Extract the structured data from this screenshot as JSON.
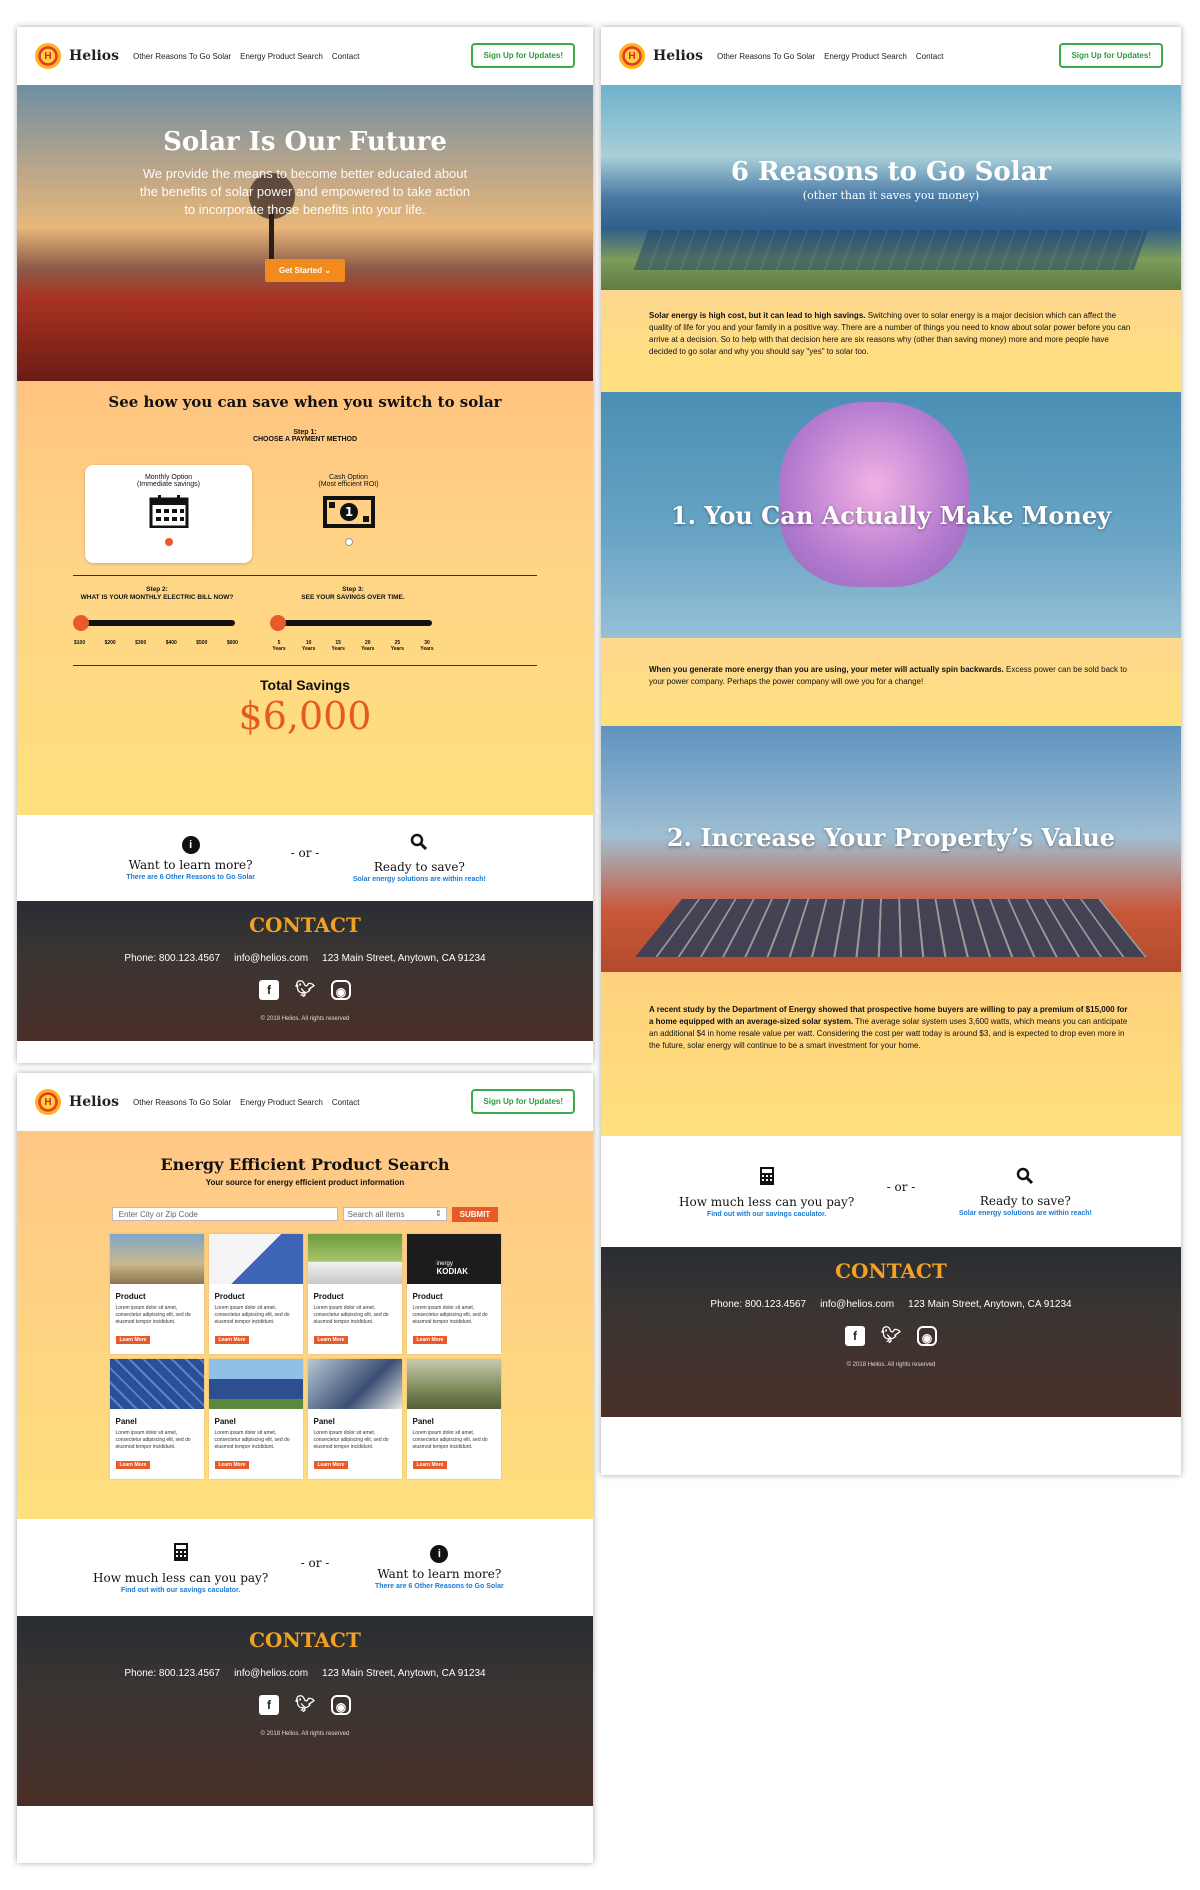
{
  "nav": {
    "brand": "Helios",
    "logo_letter": "H",
    "links": [
      "Other Reasons To Go Solar",
      "Energy Product Search",
      "Contact"
    ],
    "signup": "Sign Up for Updates!"
  },
  "home": {
    "hero_title": "Solar Is Our Future",
    "hero_text": "We provide the means to become better educated about the benefits of solar power and empowered to take action to incorporate those benefits into your life.",
    "hero_button": "Get Started",
    "calc_title": "See how you can save when you switch to solar",
    "step1_label": "Step 1:",
    "step1_text": "CHOOSE A PAYMENT METHOD",
    "option1_title": "Monthly Option",
    "option1_sub": "(Immediate savings)",
    "option2_title": "Cash Option",
    "option2_sub": "(Most efficient ROI)",
    "step2_label": "Step 2:",
    "step2_text": "WHAT IS YOUR MONTHLY ELECTRIC BILL NOW?",
    "step3_label": "Step 3:",
    "step3_text": "SEE YOUR SAVINGS OVER TIME.",
    "bill_ticks": [
      "$100",
      "$200",
      "$300",
      "$400",
      "$500",
      "$600"
    ],
    "year_ticks": [
      "5 Years",
      "10 Years",
      "15 Years",
      "20 Years",
      "25 Years",
      "30 Years"
    ],
    "total_label": "Total Savings",
    "total_value": "$6,000",
    "cta1_title": "Want to learn more?",
    "cta1_sub": "There are 6 Other Reasons to Go Solar",
    "or": "- or -",
    "cta2_title": "Ready to save?",
    "cta2_sub": "Solar energy solutions are within reach!"
  },
  "contact": {
    "title": "CONTACT",
    "phone": "Phone: 800.123.4567",
    "email": "info@helios.com",
    "address": "123 Main Street, Anytown, CA 91234",
    "copyright": "© 2018 Helios. All rights reserved"
  },
  "reasons": {
    "hero_title": "6 Reasons to Go Solar",
    "hero_sub": "(other than it saves you money)",
    "intro_bold": "Solar energy is high cost, but it can lead to high savings.",
    "intro": " Switching over to solar energy is a major decision which can affect the quality of life for you and your family in a positive way. There are a number of things you need to know about solar power before you can arrive at a decision. So to help with that decision here are six reasons why (other than saving money) more and more people have decided to go solar and why you should say \"yes\" to solar too.",
    "r1_title": "1. You Can Actually Make Money",
    "r1_bold": "When you generate more energy than you are using, your meter will actually spin backwards.",
    "r1_text": " Excess power can be sold back to your power company. Perhaps the power company will owe you for a change!",
    "r2_title": "2. Increase Your Property’s Value",
    "r2_bold": "A recent study by the Department of Energy showed that prospective home buyers are willing to pay a premium of $15,000 for a home equipped with an average-sized solar system.",
    "r2_text": " The average solar system uses 3,600 watts, which means you can anticipate an additional $4 in home resale value per watt. Considering the cost per watt today is around $3, and is expected to drop even more in the future, solar energy will continue to be a smart investment for your home.",
    "cta1_title": "How much less can you pay?",
    "cta1_sub": "Find out with our savings caculator.",
    "cta2_title": "Ready to save?",
    "cta2_sub": "Solar energy solutions are within reach!"
  },
  "search": {
    "title": "Energy Efficient Product Search",
    "sub": "Your source for energy efficient product information",
    "input_placeholder": "Enter City or Zip Code",
    "select_value": "Search all items",
    "submit": "SUBMIT",
    "card_desc": "Lorem ipsum dolor sit amet, consectetur adipiscing elit, sed do eiusmod tempor incididunt.",
    "learn_more": "Learn More",
    "cards": [
      "Product",
      "Product",
      "Product",
      "Product",
      "Panel",
      "Panel",
      "Panel",
      "Panel"
    ],
    "kodiak_brand": "inergy",
    "kodiak_label": "KODIAK",
    "cta1_title": "How much less can you pay?",
    "cta1_sub": "Find out with our savings caculator.",
    "cta2_title": "Want to learn more?",
    "cta2_sub": "There are 6 Other Reasons to Go Solar"
  }
}
